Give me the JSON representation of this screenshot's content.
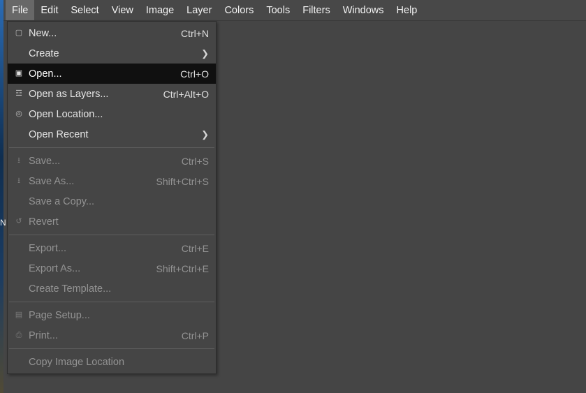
{
  "menubar": {
    "items": [
      "File",
      "Edit",
      "Select",
      "View",
      "Image",
      "Layer",
      "Colors",
      "Tools",
      "Filters",
      "Windows",
      "Help"
    ],
    "active_index": 0
  },
  "edge_letter": "N",
  "file_menu": {
    "highlighted_index": 2,
    "groups": [
      [
        {
          "icon": "new-doc-icon",
          "label": "New...",
          "shortcut": "Ctrl+N",
          "has_submenu": false,
          "enabled": true
        },
        {
          "icon": "",
          "label": "Create",
          "shortcut": "",
          "has_submenu": true,
          "enabled": true
        },
        {
          "icon": "open-icon",
          "label": "Open...",
          "shortcut": "Ctrl+O",
          "has_submenu": false,
          "enabled": true
        },
        {
          "icon": "layers-icon",
          "label": "Open as Layers...",
          "shortcut": "Ctrl+Alt+O",
          "has_submenu": false,
          "enabled": true
        },
        {
          "icon": "globe-icon",
          "label": "Open Location...",
          "shortcut": "",
          "has_submenu": false,
          "enabled": true
        },
        {
          "icon": "",
          "label": "Open Recent",
          "shortcut": "",
          "has_submenu": true,
          "enabled": true
        }
      ],
      [
        {
          "icon": "save-icon",
          "label": "Save...",
          "shortcut": "Ctrl+S",
          "has_submenu": false,
          "enabled": false
        },
        {
          "icon": "save-as-icon",
          "label": "Save As...",
          "shortcut": "Shift+Ctrl+S",
          "has_submenu": false,
          "enabled": false
        },
        {
          "icon": "",
          "label": "Save a Copy...",
          "shortcut": "",
          "has_submenu": false,
          "enabled": false
        },
        {
          "icon": "revert-icon",
          "label": "Revert",
          "shortcut": "",
          "has_submenu": false,
          "enabled": false
        }
      ],
      [
        {
          "icon": "",
          "label": "Export...",
          "shortcut": "Ctrl+E",
          "has_submenu": false,
          "enabled": false
        },
        {
          "icon": "",
          "label": "Export As...",
          "shortcut": "Shift+Ctrl+E",
          "has_submenu": false,
          "enabled": false
        },
        {
          "icon": "",
          "label": "Create Template...",
          "shortcut": "",
          "has_submenu": false,
          "enabled": false
        }
      ],
      [
        {
          "icon": "page-setup-icon",
          "label": "Page Setup...",
          "shortcut": "",
          "has_submenu": false,
          "enabled": false
        },
        {
          "icon": "print-icon",
          "label": "Print...",
          "shortcut": "Ctrl+P",
          "has_submenu": false,
          "enabled": false
        }
      ],
      [
        {
          "icon": "",
          "label": "Copy Image Location",
          "shortcut": "",
          "has_submenu": false,
          "enabled": false
        }
      ]
    ]
  },
  "submenu_glyph": "❯"
}
